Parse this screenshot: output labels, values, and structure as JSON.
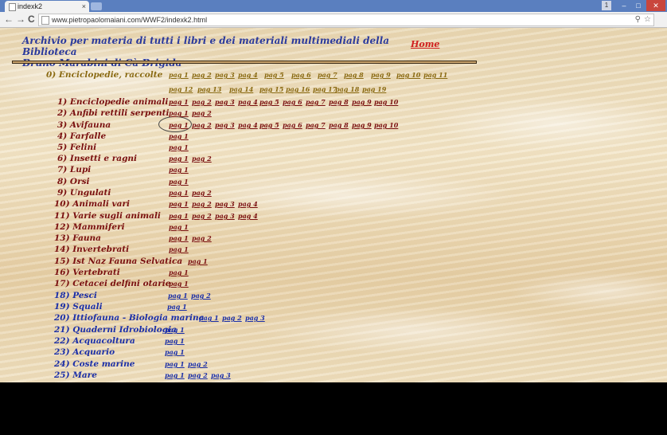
{
  "browser": {
    "tab_title": "indexk2",
    "tab_close": "×",
    "url": "www.pietropaolomaiani.com/WWF2/indexk2.html",
    "nav": {
      "back": "←",
      "forward": "→",
      "reload": "C"
    },
    "window": {
      "user": "1",
      "minimize": "–",
      "maximize": "□",
      "close": "✕"
    },
    "omni_icons": {
      "zoom": "⚲",
      "star": "☆"
    }
  },
  "page": {
    "header_line1": "Archivio per materia di tutti i libri e dei materiali multimediali della Biblioteca",
    "header_line2": "Bruno Marabini di Cà Brigida",
    "home": "Home"
  },
  "categories": [
    {
      "label": "0) Enciclopedie, raccolte",
      "color": "olive",
      "pages": [
        "pag 1",
        "pag 2",
        "pag 3",
        "pag 4",
        "pag 5",
        "pag 6",
        "pag 7",
        "pag 8",
        "pag 9",
        "pag 10",
        "pag 11"
      ],
      "pages_row2": [
        "pag 12",
        "pag 13",
        "pag 14",
        "pag 15",
        "pag 16",
        "pag 17",
        "pag 18",
        "pag 19"
      ]
    },
    {
      "label": "1) Enciclopedie animali",
      "color": "red",
      "pages": [
        "pag 1",
        "pag 2",
        "pag 3",
        "pag 4",
        "pag 5",
        "pag 6",
        "pag 7",
        "pag 8",
        "pag 9",
        "pag 10"
      ]
    },
    {
      "label": "2) Anfibi rettili serpenti",
      "color": "red",
      "pages": [
        "pag 1",
        "pag 2"
      ]
    },
    {
      "label": "3) Avifauna",
      "color": "red",
      "pages": [
        "pag 1",
        "pag 2",
        "pag 3",
        "pag 4",
        "pag 5",
        "pag 6",
        "pag 7",
        "pag 8",
        "pag 9",
        "pag 10"
      ]
    },
    {
      "label": "4) Farfalle",
      "color": "red",
      "pages": [
        "pag 1"
      ]
    },
    {
      "label": "5) Felini",
      "color": "red",
      "pages": [
        "pag 1"
      ]
    },
    {
      "label": "6) Insetti e ragni",
      "color": "red",
      "pages": [
        "pag 1",
        "pag 2"
      ]
    },
    {
      "label": "7) Lupi",
      "color": "red",
      "pages": [
        "pag 1"
      ]
    },
    {
      "label": "8) Orsi",
      "color": "red",
      "pages": [
        "pag 1"
      ]
    },
    {
      "label": "9) Ungulati",
      "color": "red",
      "pages": [
        "pag 1",
        "pag 2"
      ]
    },
    {
      "label": "10) Animali vari",
      "color": "red",
      "pages": [
        "pag 1",
        "pag 2",
        "pag 3",
        "pag 4"
      ]
    },
    {
      "label": "11) Varie sugli animali",
      "color": "red",
      "pages": [
        "pag 1",
        "pag 2",
        "pag 3",
        "pag 4"
      ]
    },
    {
      "label": "12) Mammiferi",
      "color": "red",
      "pages": [
        "pag 1"
      ]
    },
    {
      "label": "13) Fauna",
      "color": "red",
      "pages": [
        "pag 1",
        "pag 2"
      ]
    },
    {
      "label": "14) Invertebrati",
      "color": "red",
      "pages": [
        "pag 1"
      ]
    },
    {
      "label": "15) Ist Naz Fauna Selvatica",
      "color": "red",
      "pages": [
        "pag 1"
      ]
    },
    {
      "label": "16) Vertebrati",
      "color": "red",
      "pages": [
        "pag 1"
      ]
    },
    {
      "label": "17) Cetacei delfini otarie",
      "color": "red",
      "pages": [
        "pag 1"
      ]
    },
    {
      "label": "18) Pesci",
      "color": "blue",
      "pages": [
        "pag 1",
        "pag 2"
      ]
    },
    {
      "label": "19) Squali",
      "color": "blue",
      "pages": [
        "pag 1"
      ]
    },
    {
      "label": "20) Ittiofauna - Biologia marina",
      "color": "blue",
      "pages": [
        "pag 1",
        "pag 2",
        "pag 3"
      ]
    },
    {
      "label": "21) Quaderni Idrobiologia",
      "color": "blue",
      "pages": [
        "pag 1"
      ]
    },
    {
      "label": "22) Acquacoltura",
      "color": "blue",
      "pages": [
        "pag 1"
      ]
    },
    {
      "label": "23) Acquario",
      "color": "blue",
      "pages": [
        "pag 1"
      ]
    },
    {
      "label": "24) Coste marine",
      "color": "blue",
      "pages": [
        "pag 1",
        "pag 2"
      ]
    },
    {
      "label": "25) Mare",
      "color": "blue",
      "pages": [
        "pag 1",
        "pag 2",
        "pag 3"
      ]
    }
  ]
}
